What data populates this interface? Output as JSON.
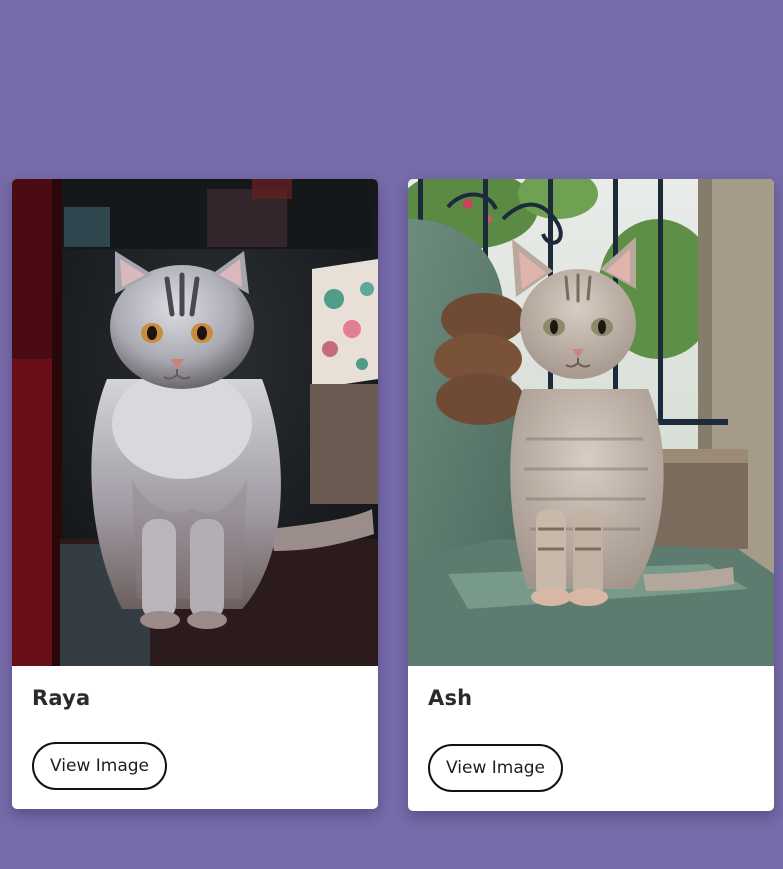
{
  "theme": {
    "background": "#776ba9",
    "card_background": "#ffffff",
    "button_border": "#111111"
  },
  "cards": [
    {
      "name": "Raya",
      "button_label": "View Image",
      "image_alt": "Raya"
    },
    {
      "name": "Ash",
      "button_label": "View Image",
      "image_alt": "Ash"
    }
  ]
}
